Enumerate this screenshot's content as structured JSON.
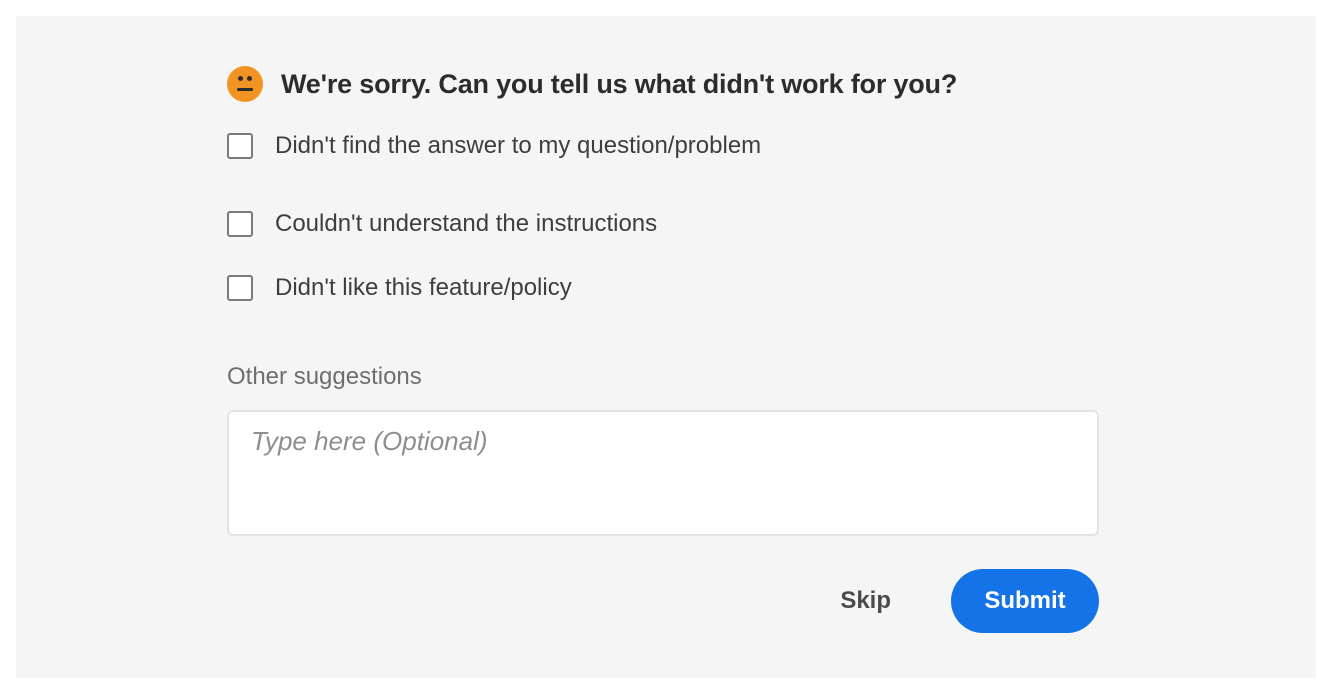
{
  "feedback": {
    "heading": "We're sorry. Can you tell us what didn't work for you?",
    "icon": "neutral-face-icon",
    "face_color": "#f29423",
    "options": [
      {
        "label": "Didn't find the answer to my question/problem",
        "checked": false
      },
      {
        "label": "Couldn't understand the instructions",
        "checked": false
      },
      {
        "label": "Didn't like this feature/policy",
        "checked": false
      }
    ],
    "other_label": "Other suggestions",
    "textarea_placeholder": "Type here (Optional)",
    "textarea_value": "",
    "skip_label": "Skip",
    "submit_label": "Submit",
    "accent_color": "#1473e6"
  }
}
